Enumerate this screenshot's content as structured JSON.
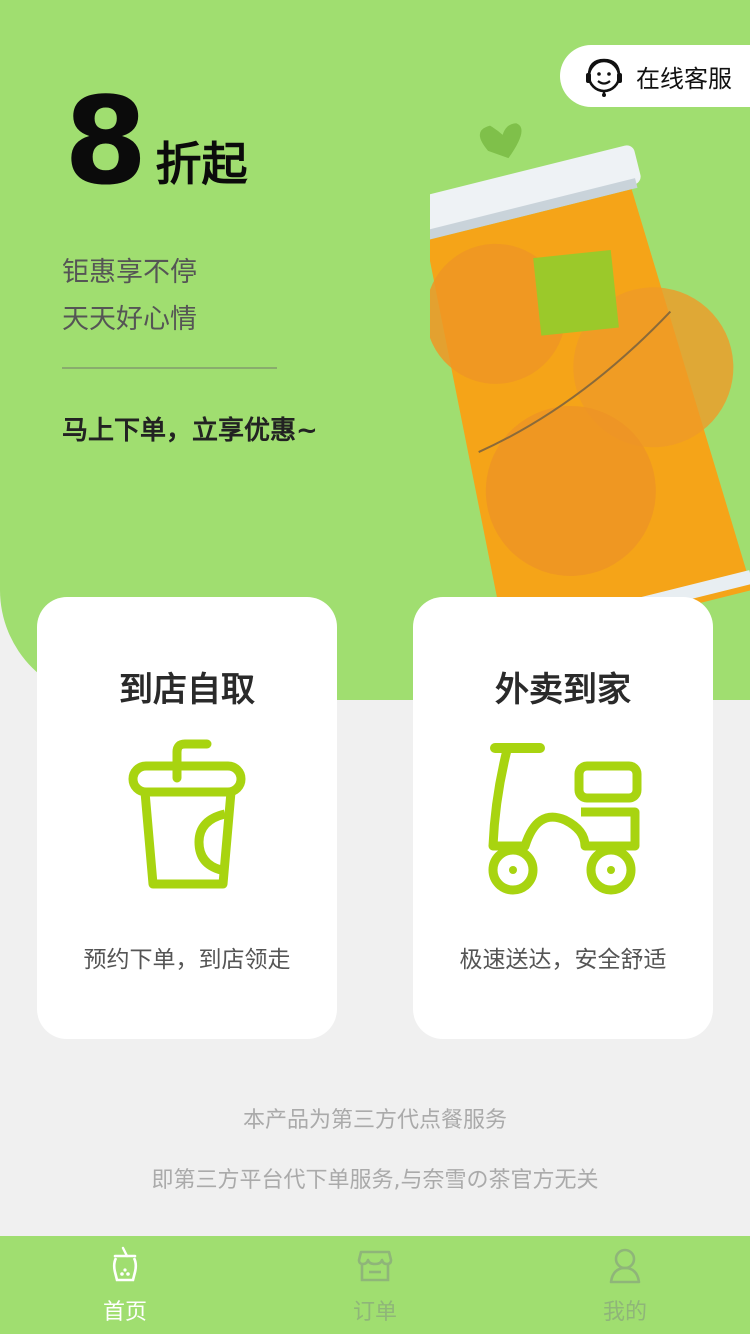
{
  "colors": {
    "accent": "#a0de70",
    "icon_green": "#a8d410",
    "card_bg": "#ffffff",
    "page_bg": "#f0f0f0"
  },
  "customer_service": {
    "label": "在线客服",
    "icon": "headset-smile-icon"
  },
  "promo": {
    "number": "8",
    "unit": "折起",
    "slogan_line1": "钜惠享不停",
    "slogan_line2": "天天好心情",
    "cta": "马上下单，立享优惠~"
  },
  "cards": [
    {
      "title": "到店自取",
      "desc": "预约下单，到店领走",
      "icon": "cup-icon"
    },
    {
      "title": "外卖到家",
      "desc": "极速送达，安全舒适",
      "icon": "scooter-icon"
    }
  ],
  "notes": {
    "line1": "本产品为第三方代点餐服务",
    "line2": "即第三方平台代下单服务,与奈雪の茶官方无关"
  },
  "tabbar": {
    "items": [
      {
        "label": "首页",
        "icon": "bubble-tea-icon",
        "active": true
      },
      {
        "label": "订单",
        "icon": "store-icon",
        "active": false
      },
      {
        "label": "我的",
        "icon": "user-icon",
        "active": false
      }
    ]
  }
}
